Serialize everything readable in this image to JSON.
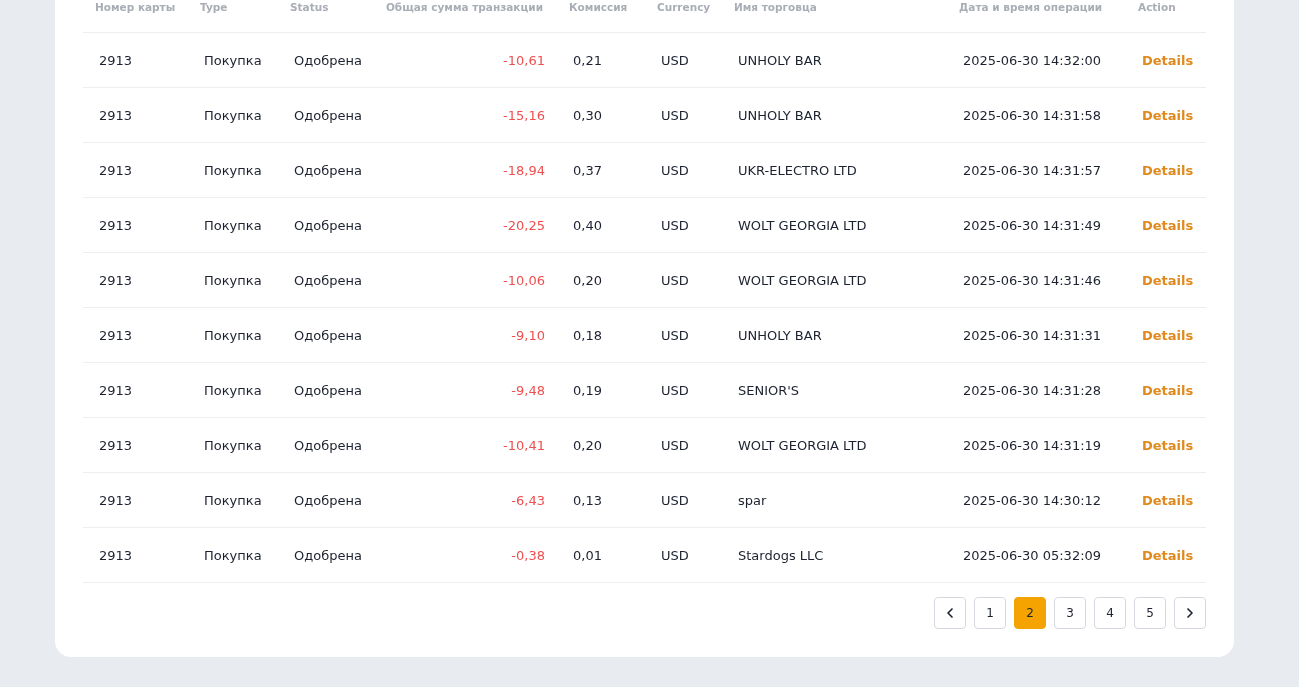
{
  "table": {
    "columns": [
      {
        "label": "Номер карты"
      },
      {
        "label": "Type"
      },
      {
        "label": "Status"
      },
      {
        "label": "Общая сумма транзакции"
      },
      {
        "label": "Комиссия"
      },
      {
        "label": "Currency"
      },
      {
        "label": "Имя торговца"
      },
      {
        "label": "Дата и время операции"
      },
      {
        "label": "Action"
      }
    ],
    "rows": [
      {
        "card": "2913",
        "type": "Покупка",
        "status": "Одобрена",
        "amount": "-10,61",
        "fee": "0,21",
        "currency": "USD",
        "merchant": "UNHOLY BAR",
        "datetime": "2025-06-30 14:32:00",
        "action": "Details"
      },
      {
        "card": "2913",
        "type": "Покупка",
        "status": "Одобрена",
        "amount": "-15,16",
        "fee": "0,30",
        "currency": "USD",
        "merchant": "UNHOLY BAR",
        "datetime": "2025-06-30 14:31:58",
        "action": "Details"
      },
      {
        "card": "2913",
        "type": "Покупка",
        "status": "Одобрена",
        "amount": "-18,94",
        "fee": "0,37",
        "currency": "USD",
        "merchant": "UKR-ELECTRO LTD",
        "datetime": "2025-06-30 14:31:57",
        "action": "Details"
      },
      {
        "card": "2913",
        "type": "Покупка",
        "status": "Одобрена",
        "amount": "-20,25",
        "fee": "0,40",
        "currency": "USD",
        "merchant": "WOLT GEORGIA LTD",
        "datetime": "2025-06-30 14:31:49",
        "action": "Details"
      },
      {
        "card": "2913",
        "type": "Покупка",
        "status": "Одобрена",
        "amount": "-10,06",
        "fee": "0,20",
        "currency": "USD",
        "merchant": "WOLT GEORGIA LTD",
        "datetime": "2025-06-30 14:31:46",
        "action": "Details"
      },
      {
        "card": "2913",
        "type": "Покупка",
        "status": "Одобрена",
        "amount": "-9,10",
        "fee": "0,18",
        "currency": "USD",
        "merchant": "UNHOLY BAR",
        "datetime": "2025-06-30 14:31:31",
        "action": "Details"
      },
      {
        "card": "2913",
        "type": "Покупка",
        "status": "Одобрена",
        "amount": "-9,48",
        "fee": "0,19",
        "currency": "USD",
        "merchant": "SENIOR'S",
        "datetime": "2025-06-30 14:31:28",
        "action": "Details"
      },
      {
        "card": "2913",
        "type": "Покупка",
        "status": "Одобрена",
        "amount": "-10,41",
        "fee": "0,20",
        "currency": "USD",
        "merchant": "WOLT GEORGIA LTD",
        "datetime": "2025-06-30 14:31:19",
        "action": "Details"
      },
      {
        "card": "2913",
        "type": "Покупка",
        "status": "Одобрена",
        "amount": "-6,43",
        "fee": "0,13",
        "currency": "USD",
        "merchant": "spar",
        "datetime": "2025-06-30 14:30:12",
        "action": "Details"
      },
      {
        "card": "2913",
        "type": "Покупка",
        "status": "Одобрена",
        "amount": "-0,38",
        "fee": "0,01",
        "currency": "USD",
        "merchant": "Stardogs LLC",
        "datetime": "2025-06-30 05:32:09",
        "action": "Details"
      }
    ]
  },
  "pagination": {
    "pages": [
      {
        "label": "1",
        "selected": false
      },
      {
        "label": "2",
        "selected": true
      },
      {
        "label": "3",
        "selected": false
      },
      {
        "label": "4",
        "selected": false
      },
      {
        "label": "5",
        "selected": false
      }
    ]
  }
}
